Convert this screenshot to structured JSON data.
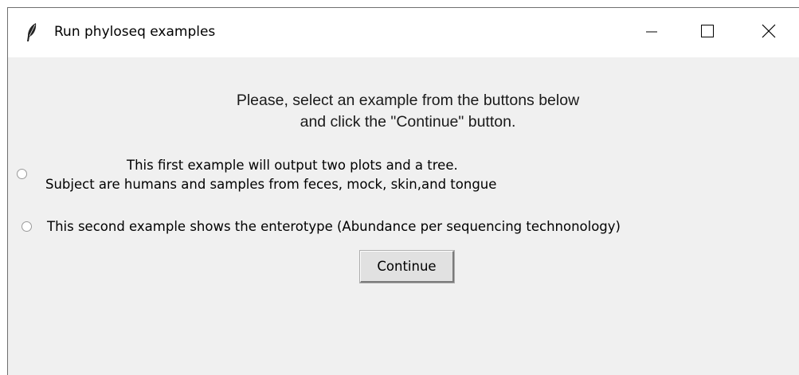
{
  "window": {
    "title": "Run phyloseq examples",
    "icons": {
      "app": "feather-icon",
      "minimize": "minimize-icon",
      "maximize": "maximize-icon",
      "close": "close-icon"
    }
  },
  "prompt": {
    "line1": "Please, select an example from the buttons below",
    "line2": "and click the \"Continue\" button."
  },
  "options": [
    {
      "line1": "This first example will output two plots and a tree.",
      "line2": "Subject are humans and samples from feces, mock, skin,and tongue",
      "selected": false
    },
    {
      "line1": "This second example shows the enterotype (Abundance per sequencing technonology)",
      "selected": false
    }
  ],
  "continue_label": "Continue",
  "colors": {
    "window_bg": "#f0f0f0",
    "titlebar_bg": "#ffffff",
    "button_bg": "#e1e1e1"
  }
}
